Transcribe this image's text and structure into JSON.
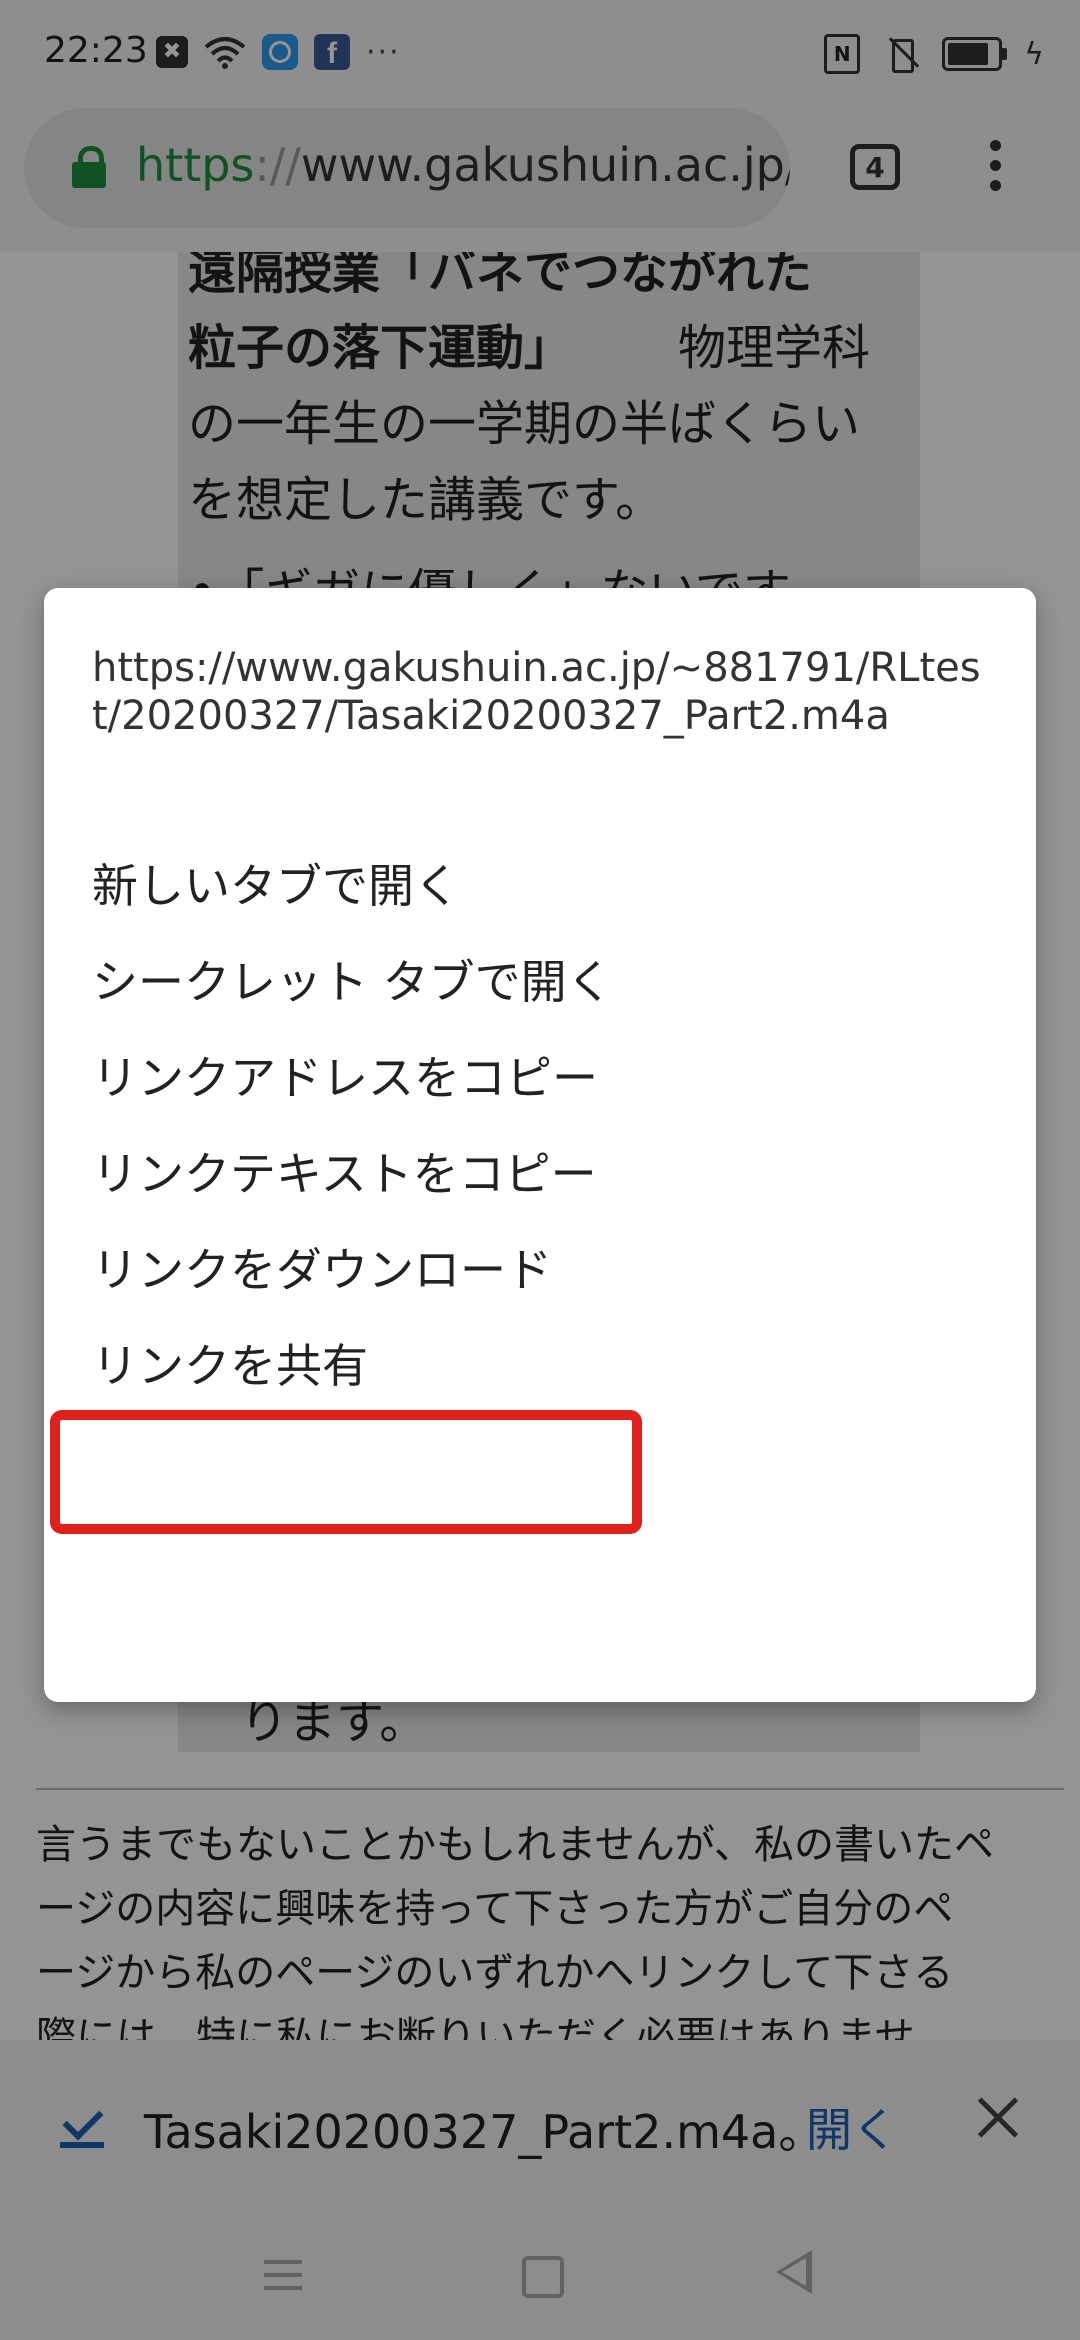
{
  "status_bar": {
    "time": "22:23",
    "more": "···",
    "nfc_label": "N",
    "fb_label": "f",
    "x_label": "✖"
  },
  "toolbar": {
    "url_scheme": "https",
    "url_sep": "://",
    "url_rest": "www.gakushuin.ac.jp/",
    "tab_count": "4"
  },
  "page": {
    "quote_lines": [
      "遠隔授業「バネでつながれた",
      "粒子の落下運動」",
      "物理学科",
      "の一年生の一学期の半ばくらい",
      "を想定した講義です。",
      "•「ギガに優しく」ないです"
    ],
    "quote_tail": "ります。",
    "paragraph_lines": [
      "言うまでもないことかもしれませんが、私の書いたペ",
      "ージの内容に興味を持って下さった方がご自分のペ",
      "ージから私のページのいずれかへリンクして下さる",
      "際には、特に私にお断りいただく必要はありませ"
    ]
  },
  "context_menu": {
    "url": "https://www.gakushuin.ac.jp/~881791/RLtest/20200327/Tasaki20200327_Part2.m4a",
    "items": [
      "新しいタブで開く",
      "シークレット タブで開く",
      "リンクアドレスをコピー",
      "リンクテキストをコピー",
      "リンクをダウンロード",
      "リンクを共有"
    ],
    "highlight_color": "#e0201a"
  },
  "download_bar": {
    "text": "Tasaki20200327_Part2.m4a。",
    "open_label": "開く"
  },
  "colors": {
    "secure_green": "#1e8e3e",
    "link_blue": "#1a5fb4"
  }
}
